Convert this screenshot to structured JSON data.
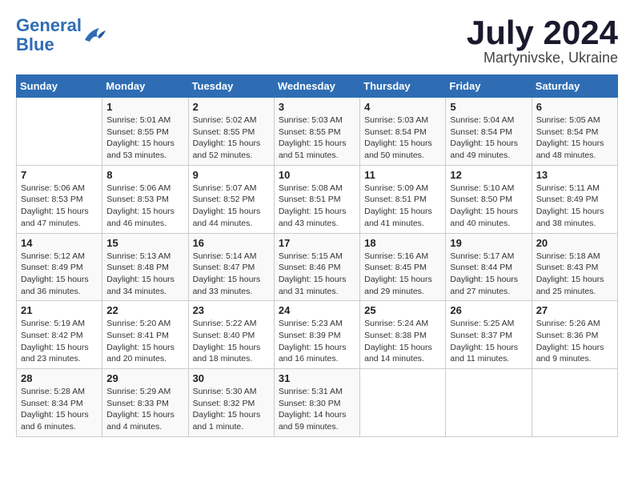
{
  "header": {
    "logo_line1": "General",
    "logo_line2": "Blue",
    "month_title": "July 2024",
    "location": "Martynivske, Ukraine"
  },
  "weekdays": [
    "Sunday",
    "Monday",
    "Tuesday",
    "Wednesday",
    "Thursday",
    "Friday",
    "Saturday"
  ],
  "weeks": [
    [
      {
        "day": "",
        "info": ""
      },
      {
        "day": "1",
        "info": "Sunrise: 5:01 AM\nSunset: 8:55 PM\nDaylight: 15 hours\nand 53 minutes."
      },
      {
        "day": "2",
        "info": "Sunrise: 5:02 AM\nSunset: 8:55 PM\nDaylight: 15 hours\nand 52 minutes."
      },
      {
        "day": "3",
        "info": "Sunrise: 5:03 AM\nSunset: 8:55 PM\nDaylight: 15 hours\nand 51 minutes."
      },
      {
        "day": "4",
        "info": "Sunrise: 5:03 AM\nSunset: 8:54 PM\nDaylight: 15 hours\nand 50 minutes."
      },
      {
        "day": "5",
        "info": "Sunrise: 5:04 AM\nSunset: 8:54 PM\nDaylight: 15 hours\nand 49 minutes."
      },
      {
        "day": "6",
        "info": "Sunrise: 5:05 AM\nSunset: 8:54 PM\nDaylight: 15 hours\nand 48 minutes."
      }
    ],
    [
      {
        "day": "7",
        "info": "Sunrise: 5:06 AM\nSunset: 8:53 PM\nDaylight: 15 hours\nand 47 minutes."
      },
      {
        "day": "8",
        "info": "Sunrise: 5:06 AM\nSunset: 8:53 PM\nDaylight: 15 hours\nand 46 minutes."
      },
      {
        "day": "9",
        "info": "Sunrise: 5:07 AM\nSunset: 8:52 PM\nDaylight: 15 hours\nand 44 minutes."
      },
      {
        "day": "10",
        "info": "Sunrise: 5:08 AM\nSunset: 8:51 PM\nDaylight: 15 hours\nand 43 minutes."
      },
      {
        "day": "11",
        "info": "Sunrise: 5:09 AM\nSunset: 8:51 PM\nDaylight: 15 hours\nand 41 minutes."
      },
      {
        "day": "12",
        "info": "Sunrise: 5:10 AM\nSunset: 8:50 PM\nDaylight: 15 hours\nand 40 minutes."
      },
      {
        "day": "13",
        "info": "Sunrise: 5:11 AM\nSunset: 8:49 PM\nDaylight: 15 hours\nand 38 minutes."
      }
    ],
    [
      {
        "day": "14",
        "info": "Sunrise: 5:12 AM\nSunset: 8:49 PM\nDaylight: 15 hours\nand 36 minutes."
      },
      {
        "day": "15",
        "info": "Sunrise: 5:13 AM\nSunset: 8:48 PM\nDaylight: 15 hours\nand 34 minutes."
      },
      {
        "day": "16",
        "info": "Sunrise: 5:14 AM\nSunset: 8:47 PM\nDaylight: 15 hours\nand 33 minutes."
      },
      {
        "day": "17",
        "info": "Sunrise: 5:15 AM\nSunset: 8:46 PM\nDaylight: 15 hours\nand 31 minutes."
      },
      {
        "day": "18",
        "info": "Sunrise: 5:16 AM\nSunset: 8:45 PM\nDaylight: 15 hours\nand 29 minutes."
      },
      {
        "day": "19",
        "info": "Sunrise: 5:17 AM\nSunset: 8:44 PM\nDaylight: 15 hours\nand 27 minutes."
      },
      {
        "day": "20",
        "info": "Sunrise: 5:18 AM\nSunset: 8:43 PM\nDaylight: 15 hours\nand 25 minutes."
      }
    ],
    [
      {
        "day": "21",
        "info": "Sunrise: 5:19 AM\nSunset: 8:42 PM\nDaylight: 15 hours\nand 23 minutes."
      },
      {
        "day": "22",
        "info": "Sunrise: 5:20 AM\nSunset: 8:41 PM\nDaylight: 15 hours\nand 20 minutes."
      },
      {
        "day": "23",
        "info": "Sunrise: 5:22 AM\nSunset: 8:40 PM\nDaylight: 15 hours\nand 18 minutes."
      },
      {
        "day": "24",
        "info": "Sunrise: 5:23 AM\nSunset: 8:39 PM\nDaylight: 15 hours\nand 16 minutes."
      },
      {
        "day": "25",
        "info": "Sunrise: 5:24 AM\nSunset: 8:38 PM\nDaylight: 15 hours\nand 14 minutes."
      },
      {
        "day": "26",
        "info": "Sunrise: 5:25 AM\nSunset: 8:37 PM\nDaylight: 15 hours\nand 11 minutes."
      },
      {
        "day": "27",
        "info": "Sunrise: 5:26 AM\nSunset: 8:36 PM\nDaylight: 15 hours\nand 9 minutes."
      }
    ],
    [
      {
        "day": "28",
        "info": "Sunrise: 5:28 AM\nSunset: 8:34 PM\nDaylight: 15 hours\nand 6 minutes."
      },
      {
        "day": "29",
        "info": "Sunrise: 5:29 AM\nSunset: 8:33 PM\nDaylight: 15 hours\nand 4 minutes."
      },
      {
        "day": "30",
        "info": "Sunrise: 5:30 AM\nSunset: 8:32 PM\nDaylight: 15 hours\nand 1 minute."
      },
      {
        "day": "31",
        "info": "Sunrise: 5:31 AM\nSunset: 8:30 PM\nDaylight: 14 hours\nand 59 minutes."
      },
      {
        "day": "",
        "info": ""
      },
      {
        "day": "",
        "info": ""
      },
      {
        "day": "",
        "info": ""
      }
    ]
  ]
}
